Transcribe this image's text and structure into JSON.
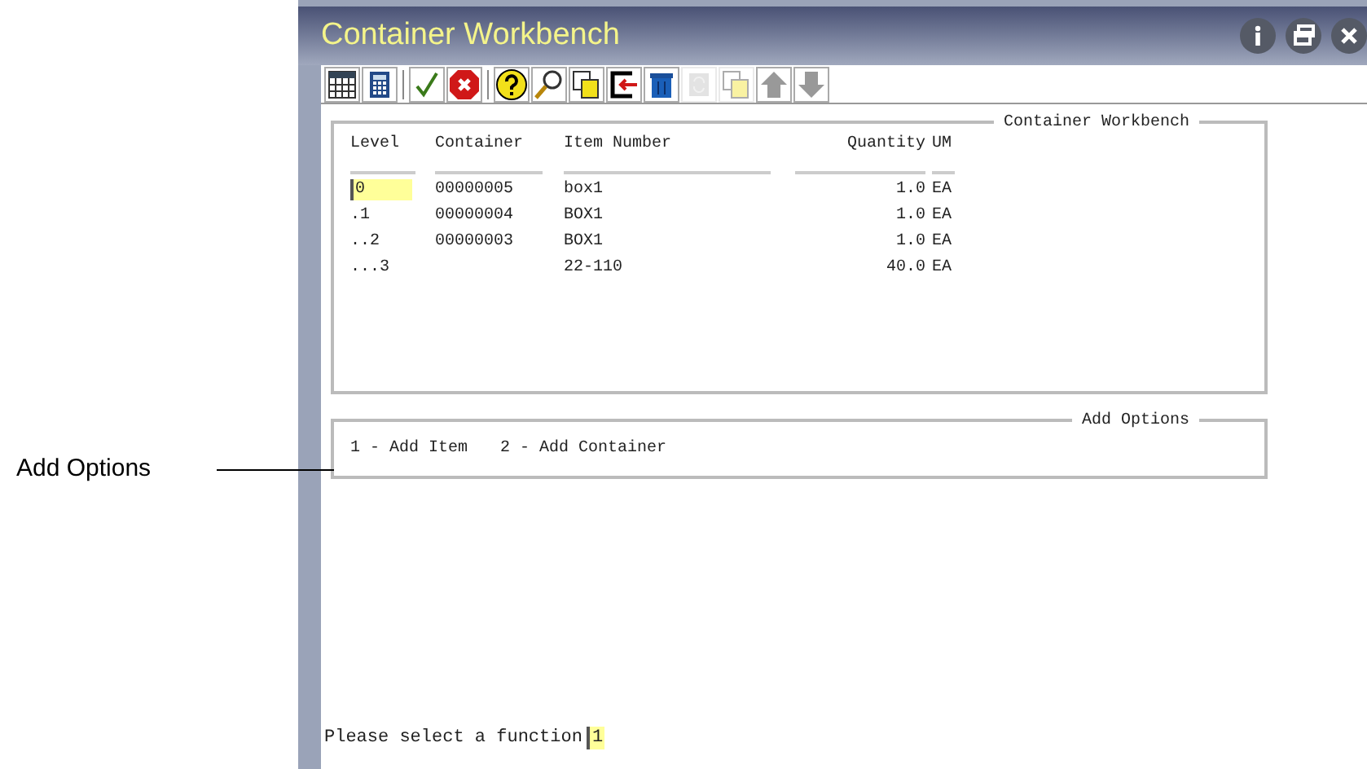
{
  "window": {
    "title": "Container Workbench"
  },
  "title_buttons": [
    {
      "kind": "info"
    },
    {
      "kind": "restore"
    },
    {
      "kind": "close"
    }
  ],
  "toolbar": [
    {
      "kind": "grid",
      "disabled": false
    },
    {
      "kind": "calculator",
      "disabled": false
    },
    {
      "kind": "check",
      "disabled": false
    },
    {
      "kind": "cancel",
      "disabled": false
    },
    {
      "kind": "help",
      "disabled": false
    },
    {
      "kind": "search",
      "disabled": false
    },
    {
      "kind": "copy",
      "disabled": false
    },
    {
      "kind": "exit",
      "disabled": false
    },
    {
      "kind": "delete",
      "disabled": false
    },
    {
      "kind": "refresh",
      "disabled": true
    },
    {
      "kind": "copy",
      "disabled": true
    },
    {
      "kind": "up",
      "disabled": false
    },
    {
      "kind": "down",
      "disabled": false
    }
  ],
  "table": {
    "title": "Container Workbench",
    "columns": [
      "Level",
      "Container",
      "Item Number",
      "Quantity",
      "UM"
    ],
    "rows": [
      {
        "cells": [
          "0",
          "00000005",
          "box1",
          "1.0",
          "EA"
        ],
        "selected": true
      },
      {
        "cells": [
          ".1",
          "00000004",
          "BOX1",
          "1.0",
          "EA"
        ],
        "selected": false
      },
      {
        "cells": [
          "..2",
          "00000003",
          "BOX1",
          "1.0",
          "EA"
        ],
        "selected": false
      },
      {
        "cells": [
          "...3",
          "",
          "22-110",
          "40.0",
          "EA"
        ],
        "selected": false
      }
    ]
  },
  "add_options": {
    "title": "Add Options",
    "options": [
      "1 - Add Item",
      "2 - Add Container"
    ]
  },
  "callout": {
    "label": "Add Options"
  },
  "prompt": {
    "label": "Please select a function",
    "value": "1"
  }
}
